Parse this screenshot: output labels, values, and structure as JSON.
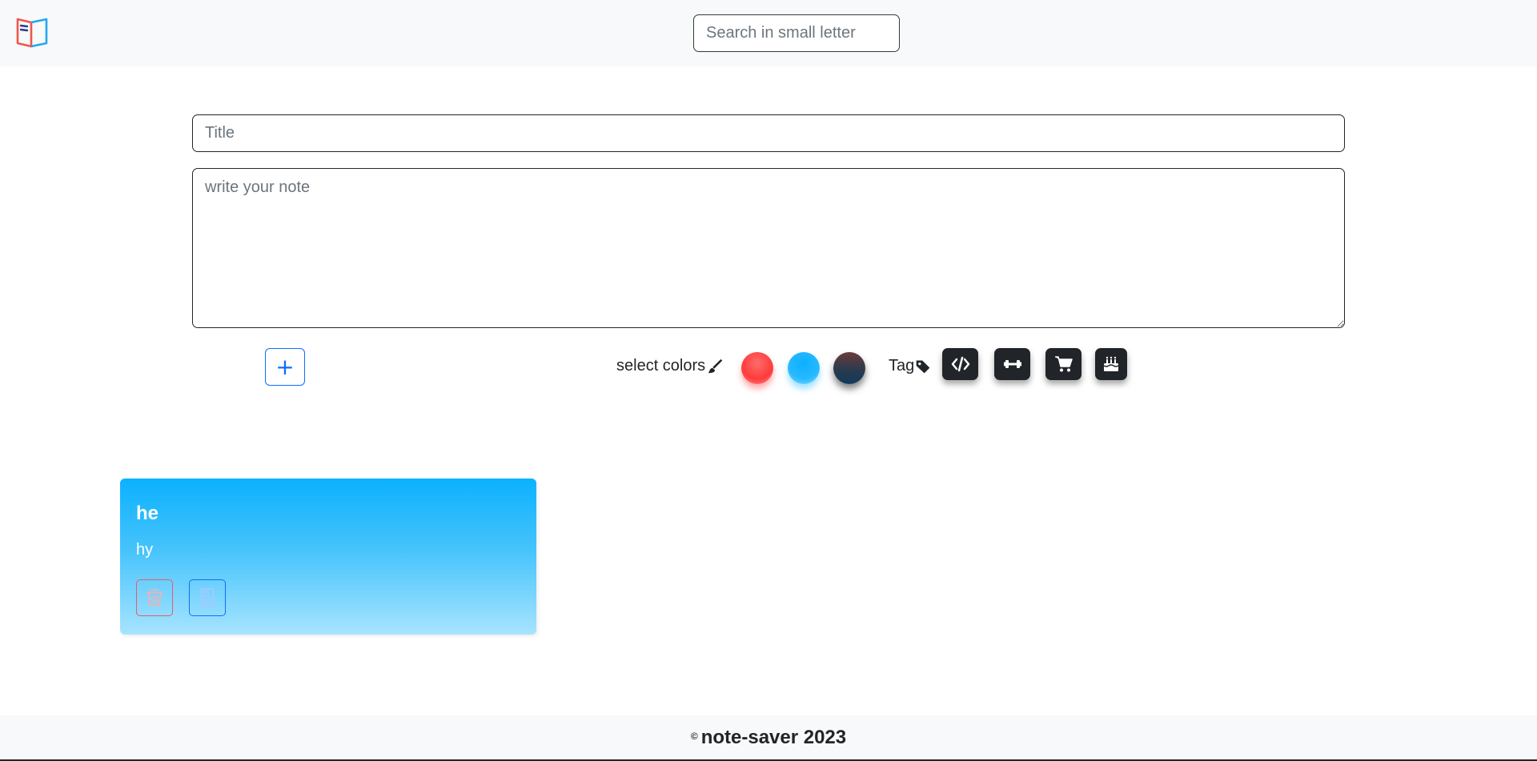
{
  "header": {
    "logo_icon": "open-book-icon",
    "search_placeholder": "Search in small letter"
  },
  "form": {
    "title_placeholder": "Title",
    "note_placeholder": "write your note",
    "add_label": "+",
    "select_colors_label": "select colors",
    "brush_icon": "paintbrush-icon",
    "colors": [
      "#ff4b4b",
      "#1db5ff",
      "#2a3a4e"
    ],
    "tag_label": "Tag",
    "tag_icon": "tag-icon",
    "tags": [
      "code-icon",
      "dumbbell-icon",
      "cart-icon",
      "cake-icon"
    ]
  },
  "notes": [
    {
      "title": "he",
      "body": "hy",
      "delete_icon": "trash-icon",
      "edit_icon": "document-icon"
    }
  ],
  "footer": {
    "copyright_symbol": "©",
    "text": "note-saver 2023"
  }
}
